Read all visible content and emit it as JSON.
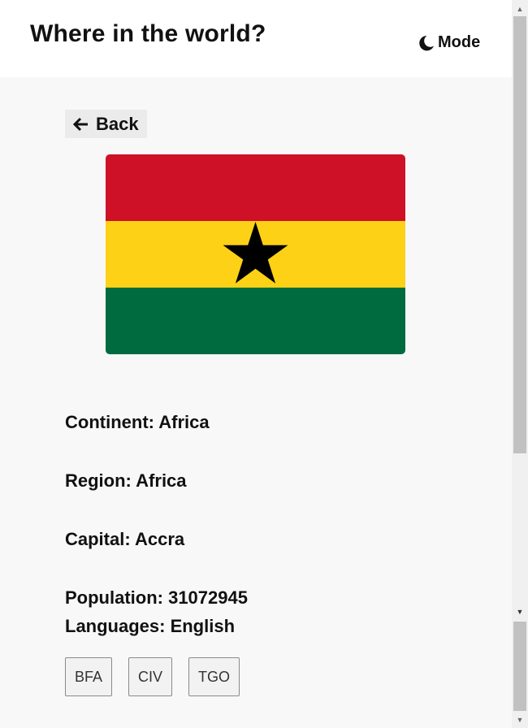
{
  "header": {
    "title": "Where in the world?",
    "mode_label": "Mode"
  },
  "back_label": "Back",
  "country": {
    "flag_colors": [
      "#ce1126",
      "#fcd116",
      "#006b3f"
    ],
    "flag_star_color": "#000000",
    "details": {
      "continent": "Continent: Africa",
      "region": "Region: Africa",
      "capital": "Capital: Accra",
      "population": "Population: 31072945",
      "languages": "Languages: English"
    },
    "borders": [
      "BFA",
      "CIV",
      "TGO"
    ]
  },
  "icons": {
    "mode": "moon-icon",
    "back": "arrow-left-icon",
    "scroll_up": "chevron-up-icon",
    "scroll_down": "chevron-down-icon"
  }
}
